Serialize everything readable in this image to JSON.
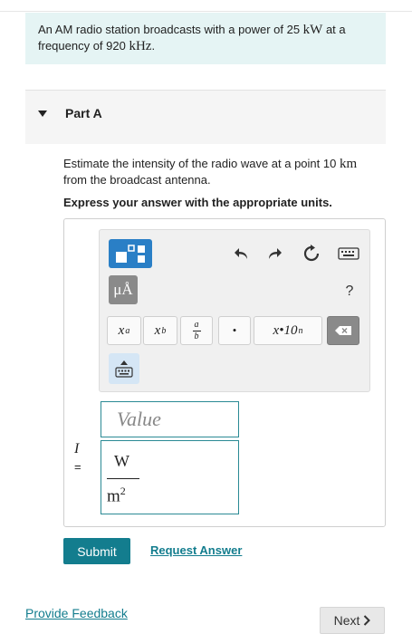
{
  "problem": {
    "text_before_power": "An AM radio station broadcasts with a power of 25 ",
    "power_unit": "kW",
    "text_before_freq": " at a frequency of 920 ",
    "freq_unit": "kHz",
    "text_end": "."
  },
  "part": {
    "title": "Part A"
  },
  "question": {
    "text_before_dist": "Estimate the intensity of the radio wave at a point 10 ",
    "dist_unit": "km",
    "text_after_dist": " from the broadcast antenna."
  },
  "instruction": "Express your answer with the appropriate units.",
  "toolbar": {
    "units_label": "μÅ",
    "help_label": "?",
    "keys": {
      "superscript_base": "x",
      "superscript_exp": "a",
      "subscript_base": "x",
      "subscript_sub": "b",
      "fraction_num": "a",
      "fraction_den": "b",
      "dot": "•",
      "sci_label": "x•10",
      "sci_exp": "n"
    }
  },
  "answer": {
    "variable": "I",
    "equals": "=",
    "value_placeholder": "Value",
    "unit_numerator": "W",
    "unit_denominator": "m",
    "unit_denominator_exp": "2"
  },
  "actions": {
    "submit_label": "Submit",
    "request_answer_label": "Request Answer"
  },
  "footer": {
    "feedback_label": "Provide Feedback",
    "next_label": "Next"
  },
  "colors": {
    "teal": "#137d8e",
    "problem_bg": "#e5f4f4",
    "toolbar_blue": "#2a7fc6"
  }
}
